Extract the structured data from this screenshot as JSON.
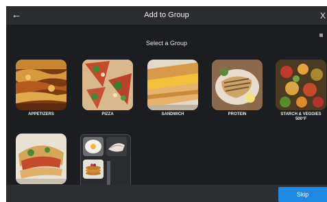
{
  "header": {
    "back_icon": "arrow-left-icon",
    "title": "Add to Group",
    "close_icon": "close-icon",
    "close_label": "X"
  },
  "subtitle": "Select a Group",
  "groups": [
    {
      "label": "APPETIZERS"
    },
    {
      "label": "PIZZA"
    },
    {
      "label": "SANDWICH"
    },
    {
      "label": "PROTEIN"
    },
    {
      "label": "STARCH & VEGGIES\n500°F"
    }
  ],
  "footer": {
    "skip_label": "Skip"
  },
  "colors": {
    "background": "#1c1d20",
    "header": "#2b2c2f",
    "accent": "#1e88e5"
  }
}
